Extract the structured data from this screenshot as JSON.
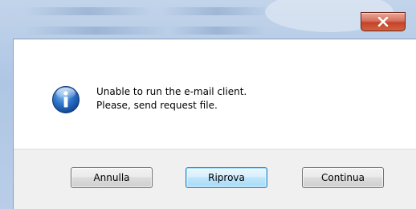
{
  "dialog": {
    "close_icon": "close-icon",
    "message_icon": "information-icon",
    "message_line1": "Unable to run the e-mail client.",
    "message_line2": "Please, send request file."
  },
  "buttons": {
    "cancel_label": "Annulla",
    "retry_label": "Riprova",
    "continue_label": "Continua"
  },
  "colors": {
    "close_button": "#c7482e",
    "info_icon": "#1f5fb0",
    "button_bar": "#f0f0f0",
    "default_button_border": "#3c7fb1"
  }
}
